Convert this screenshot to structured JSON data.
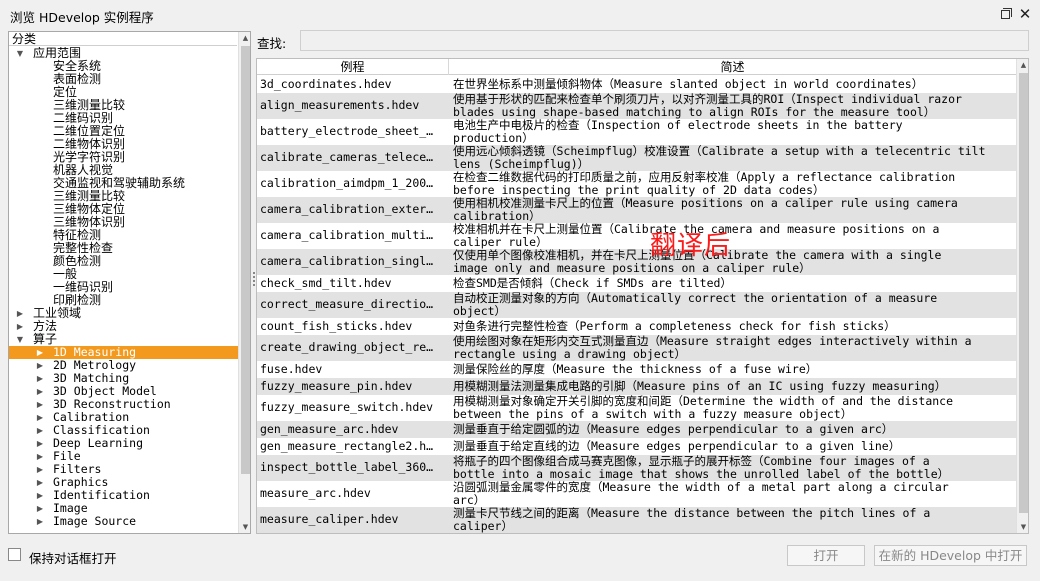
{
  "window": {
    "title": "浏览 HDevelop 实例程序",
    "restore_icon": "restore-icon",
    "close_glyph": "✕"
  },
  "tree": {
    "header": "分类",
    "items": [
      {
        "label": "应用范围",
        "level": 1,
        "expander": "down",
        "mono": false
      },
      {
        "label": "安全系统",
        "level": 2,
        "expander": "",
        "mono": false
      },
      {
        "label": "表面检测",
        "level": 2,
        "expander": "",
        "mono": false
      },
      {
        "label": "定位",
        "level": 2,
        "expander": "",
        "mono": false
      },
      {
        "label": "三维测量比较",
        "level": 2,
        "expander": "",
        "mono": false
      },
      {
        "label": "二维码识别",
        "level": 2,
        "expander": "",
        "mono": false
      },
      {
        "label": "二维位置定位",
        "level": 2,
        "expander": "",
        "mono": false
      },
      {
        "label": "二维物体识别",
        "level": 2,
        "expander": "",
        "mono": false
      },
      {
        "label": "光学字符识别",
        "level": 2,
        "expander": "",
        "mono": false
      },
      {
        "label": "机器人视觉",
        "level": 2,
        "expander": "",
        "mono": false
      },
      {
        "label": "交通监视和驾驶辅助系统",
        "level": 2,
        "expander": "",
        "mono": false
      },
      {
        "label": "三维测量比较",
        "level": 2,
        "expander": "",
        "mono": false
      },
      {
        "label": "三维物体定位",
        "level": 2,
        "expander": "",
        "mono": false
      },
      {
        "label": "三维物体识别",
        "level": 2,
        "expander": "",
        "mono": false
      },
      {
        "label": "特征检测",
        "level": 2,
        "expander": "",
        "mono": false
      },
      {
        "label": "完整性检查",
        "level": 2,
        "expander": "",
        "mono": false
      },
      {
        "label": "颜色检测",
        "level": 2,
        "expander": "",
        "mono": false
      },
      {
        "label": "一般",
        "level": 2,
        "expander": "",
        "mono": false
      },
      {
        "label": "一维码识别",
        "level": 2,
        "expander": "",
        "mono": false
      },
      {
        "label": "印刷检测",
        "level": 2,
        "expander": "",
        "mono": false
      },
      {
        "label": "工业领域",
        "level": 1,
        "expander": "right",
        "mono": false
      },
      {
        "label": "方法",
        "level": 1,
        "expander": "right",
        "mono": false
      },
      {
        "label": "算子",
        "level": 1,
        "expander": "down",
        "mono": false
      },
      {
        "label": "1D Measuring",
        "level": 2,
        "expander": "right",
        "mono": true,
        "selected": true
      },
      {
        "label": "2D Metrology",
        "level": 2,
        "expander": "right",
        "mono": true
      },
      {
        "label": "3D Matching",
        "level": 2,
        "expander": "right",
        "mono": true
      },
      {
        "label": "3D Object Model",
        "level": 2,
        "expander": "right",
        "mono": true
      },
      {
        "label": "3D Reconstruction",
        "level": 2,
        "expander": "right",
        "mono": true
      },
      {
        "label": "Calibration",
        "level": 2,
        "expander": "right",
        "mono": true
      },
      {
        "label": "Classification",
        "level": 2,
        "expander": "right",
        "mono": true
      },
      {
        "label": "Deep Learning",
        "level": 2,
        "expander": "right",
        "mono": true
      },
      {
        "label": "File",
        "level": 2,
        "expander": "right",
        "mono": true
      },
      {
        "label": "Filters",
        "level": 2,
        "expander": "right",
        "mono": true
      },
      {
        "label": "Graphics",
        "level": 2,
        "expander": "right",
        "mono": true
      },
      {
        "label": "Identification",
        "level": 2,
        "expander": "right",
        "mono": true
      },
      {
        "label": "Image",
        "level": 2,
        "expander": "right",
        "mono": true
      },
      {
        "label": "Image Source",
        "level": 2,
        "expander": "right",
        "mono": true
      }
    ]
  },
  "search": {
    "label": "查找:",
    "value": ""
  },
  "table": {
    "columns": [
      "例程",
      "简述"
    ],
    "rows": [
      {
        "name": "3d_coordinates.hdev",
        "desc": [
          "在世界坐标系中测量倾斜物体（Measure slanted object in world coordinates）"
        ]
      },
      {
        "name": "align_measurements.hdev",
        "desc": [
          "使用基于形状的匹配来检查单个刷须刀片，以对齐测量工具的ROI（Inspect individual razor",
          "blades using shape-based matching to align ROIs for the measure tool）"
        ]
      },
      {
        "name": "battery_electrode_sheet_…",
        "desc": [
          "电池生产中电极片的检查（Inspection of electrode sheets in the battery",
          "production）"
        ]
      },
      {
        "name": "calibrate_cameras_telece…",
        "desc": [
          "使用远心倾斜透镜（Scheimpflug）校准设置（Calibrate a setup with a telecentric tilt",
          "lens (Scheimpflug)）"
        ]
      },
      {
        "name": "calibration_aimdpm_1_200…",
        "desc": [
          "在检查二维数据代码的打印质量之前，应用反射率校准（Apply a reflectance calibration",
          "before inspecting the print quality of 2D data codes）"
        ]
      },
      {
        "name": "camera_calibration_exter…",
        "desc": [
          "使用相机校准测量卡尺上的位置（Measure positions on a caliper rule using camera",
          "calibration）"
        ]
      },
      {
        "name": "camera_calibration_multi…",
        "desc": [
          "校准相机并在卡尺上测量位置（Calibrate the camera and measure positions on a",
          "caliper rule）"
        ]
      },
      {
        "name": "camera_calibration_singl…",
        "desc": [
          "仅使用单个图像校准相机，并在卡尺上测量位置（Calibrate the camera with a single",
          "image only and measure positions on a caliper rule）"
        ]
      },
      {
        "name": "check_smd_tilt.hdev",
        "desc": [
          "检查SMD是否倾斜（Check if SMDs are tilted）"
        ]
      },
      {
        "name": "correct_measure_directio…",
        "desc": [
          "自动校正测量对象的方向（Automatically correct the orientation of a measure",
          "object）"
        ]
      },
      {
        "name": "count_fish_sticks.hdev",
        "desc": [
          "对鱼条进行完整性检查（Perform a completeness check for fish sticks）"
        ]
      },
      {
        "name": "create_drawing_object_re…",
        "desc": [
          "使用绘图对象在矩形内交互式测量直边（Measure straight edges interactively within a",
          "rectangle using a drawing object）"
        ]
      },
      {
        "name": "fuse.hdev",
        "desc": [
          "测量保险丝的厚度（Measure the thickness of a fuse wire）"
        ]
      },
      {
        "name": "fuzzy_measure_pin.hdev",
        "desc": [
          "用模糊测量法测量集成电路的引脚（Measure pins of an IC using fuzzy measuring）"
        ]
      },
      {
        "name": "fuzzy_measure_switch.hdev",
        "desc": [
          "用模糊测量对象确定开关引脚的宽度和间距（Determine the width of and the distance",
          "between the pins of a switch with a fuzzy measure object）"
        ]
      },
      {
        "name": "gen_measure_arc.hdev",
        "desc": [
          "测量垂直于给定圆弧的边（Measure edges perpendicular to a given arc）"
        ]
      },
      {
        "name": "gen_measure_rectangle2.h…",
        "desc": [
          "测量垂直于给定直线的边（Measure edges perpendicular to a given line）"
        ]
      },
      {
        "name": "inspect_bottle_label_360…",
        "desc": [
          "将瓶子的四个图像组合成马赛克图像，显示瓶子的展开标签（Combine four images of a",
          "bottle into a mosaic image that shows the unrolled label of the bottle）"
        ]
      },
      {
        "name": "measure_arc.hdev",
        "desc": [
          "沿圆弧测量金属零件的宽度（Measure the width of a metal part along a circular",
          "arc）"
        ]
      },
      {
        "name": "measure_caliper.hdev",
        "desc": [
          "测量卡尺节线之间的距离（Measure the distance between the pitch lines of a",
          "caliper）"
        ]
      }
    ]
  },
  "watermark": "翻译后",
  "footer": {
    "keep_open_label": "保持对话框打开",
    "open_button": "打开",
    "open_new_button": "在新的 HDevelop 中打开"
  },
  "colors": {
    "selection": "#f39a1e",
    "alt_row": "#e2e2e2",
    "watermark": "#ff1a1a"
  }
}
